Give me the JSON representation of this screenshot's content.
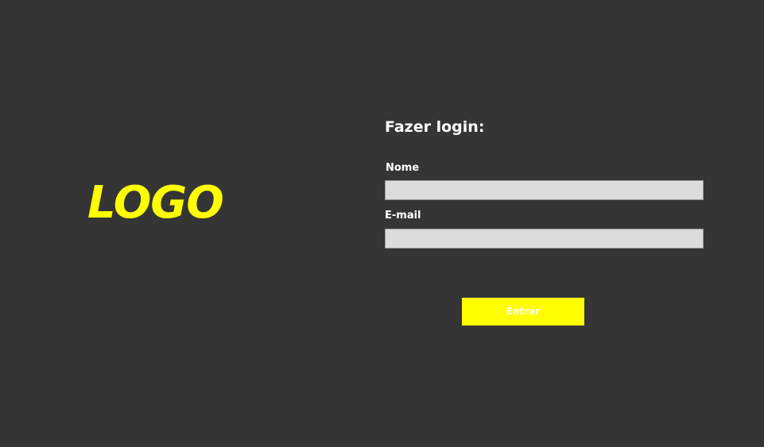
{
  "logo": {
    "text": "LOGO"
  },
  "login": {
    "title": "Fazer login:",
    "fields": {
      "name": {
        "label": "Nome",
        "value": "",
        "placeholder": ""
      },
      "email": {
        "label": "E-mail",
        "value": "",
        "placeholder": ""
      }
    },
    "submit_label": "Entrar"
  },
  "colors": {
    "background": "#353535",
    "accent": "#ffff00",
    "input_background": "#dcdcdc",
    "text": "#ffffff"
  }
}
